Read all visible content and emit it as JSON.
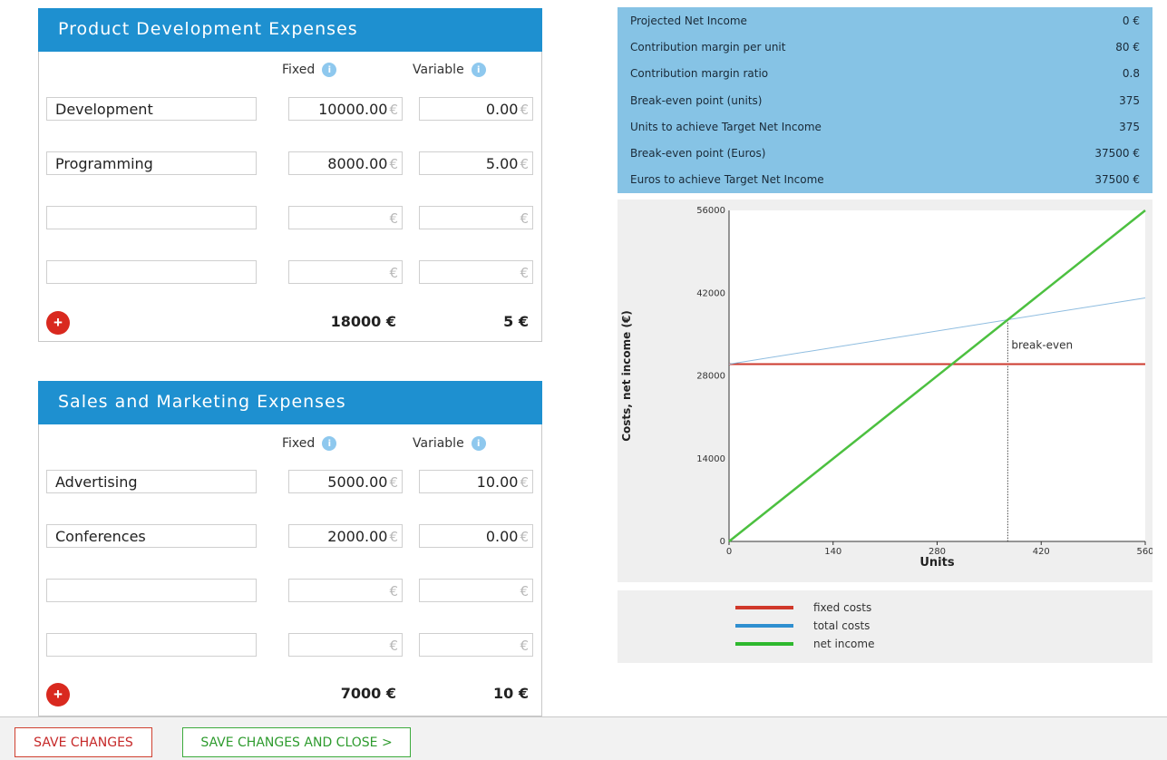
{
  "sections": [
    {
      "title": "Product Development Expenses",
      "fixed_label": "Fixed",
      "variable_label": "Variable",
      "rows": [
        {
          "name": "Development",
          "fixed": "10000.00",
          "variable": "0.00"
        },
        {
          "name": "Programming",
          "fixed": "8000.00",
          "variable": "5.00"
        },
        {
          "name": "",
          "fixed": "",
          "variable": ""
        },
        {
          "name": "",
          "fixed": "",
          "variable": ""
        }
      ],
      "currency": "€",
      "total_fixed": "18000 €",
      "total_variable": "5 €"
    },
    {
      "title": "Sales and Marketing Expenses",
      "fixed_label": "Fixed",
      "variable_label": "Variable",
      "rows": [
        {
          "name": "Advertising",
          "fixed": "5000.00",
          "variable": "10.00"
        },
        {
          "name": "Conferences",
          "fixed": "2000.00",
          "variable": "0.00"
        },
        {
          "name": "",
          "fixed": "",
          "variable": ""
        },
        {
          "name": "",
          "fixed": "",
          "variable": ""
        }
      ],
      "currency": "€",
      "total_fixed": "7000 €",
      "total_variable": "10 €"
    }
  ],
  "summary": [
    {
      "label": "Projected Net Income",
      "value": "0 €"
    },
    {
      "label": "Contribution margin per unit",
      "value": "80 €"
    },
    {
      "label": "Contribution margin ratio",
      "value": "0.8"
    },
    {
      "label": "Break-even point (units)",
      "value": "375"
    },
    {
      "label": "Units to achieve Target Net Income",
      "value": "375"
    },
    {
      "label": "Break-even point (Euros)",
      "value": "37500 €"
    },
    {
      "label": "Euros to achieve Target Net Income",
      "value": "37500 €"
    }
  ],
  "chart_data": {
    "type": "line",
    "xlabel": "Units",
    "ylabel": "Costs, net income (€)",
    "xlim": [
      0,
      560
    ],
    "ylim": [
      0,
      56000
    ],
    "xticks": [
      0,
      140,
      280,
      420,
      560
    ],
    "yticks": [
      0,
      14000,
      28000,
      42000,
      56000
    ],
    "series": [
      {
        "name": "fixed costs",
        "color": "#cc3a2e",
        "x": [
          0,
          560
        ],
        "y": [
          30000,
          30000
        ]
      },
      {
        "name": "total costs",
        "color": "#8fbde0",
        "x": [
          0,
          560
        ],
        "y": [
          30000,
          41200
        ]
      },
      {
        "name": "net income",
        "color": "#4cc040",
        "x": [
          0,
          560
        ],
        "y": [
          0,
          56000
        ]
      }
    ],
    "annotation": {
      "label": "break-even",
      "x": 375
    },
    "legend_position": "bottom"
  },
  "legend": [
    {
      "label": "fixed costs",
      "color": "#d0382a"
    },
    {
      "label": "total costs",
      "color": "#2f8fd0"
    },
    {
      "label": "net income",
      "color": "#2eb82e"
    }
  ],
  "footer": {
    "save_label": "SAVE CHANGES",
    "save_close_label": "SAVE CHANGES AND CLOSE >"
  }
}
